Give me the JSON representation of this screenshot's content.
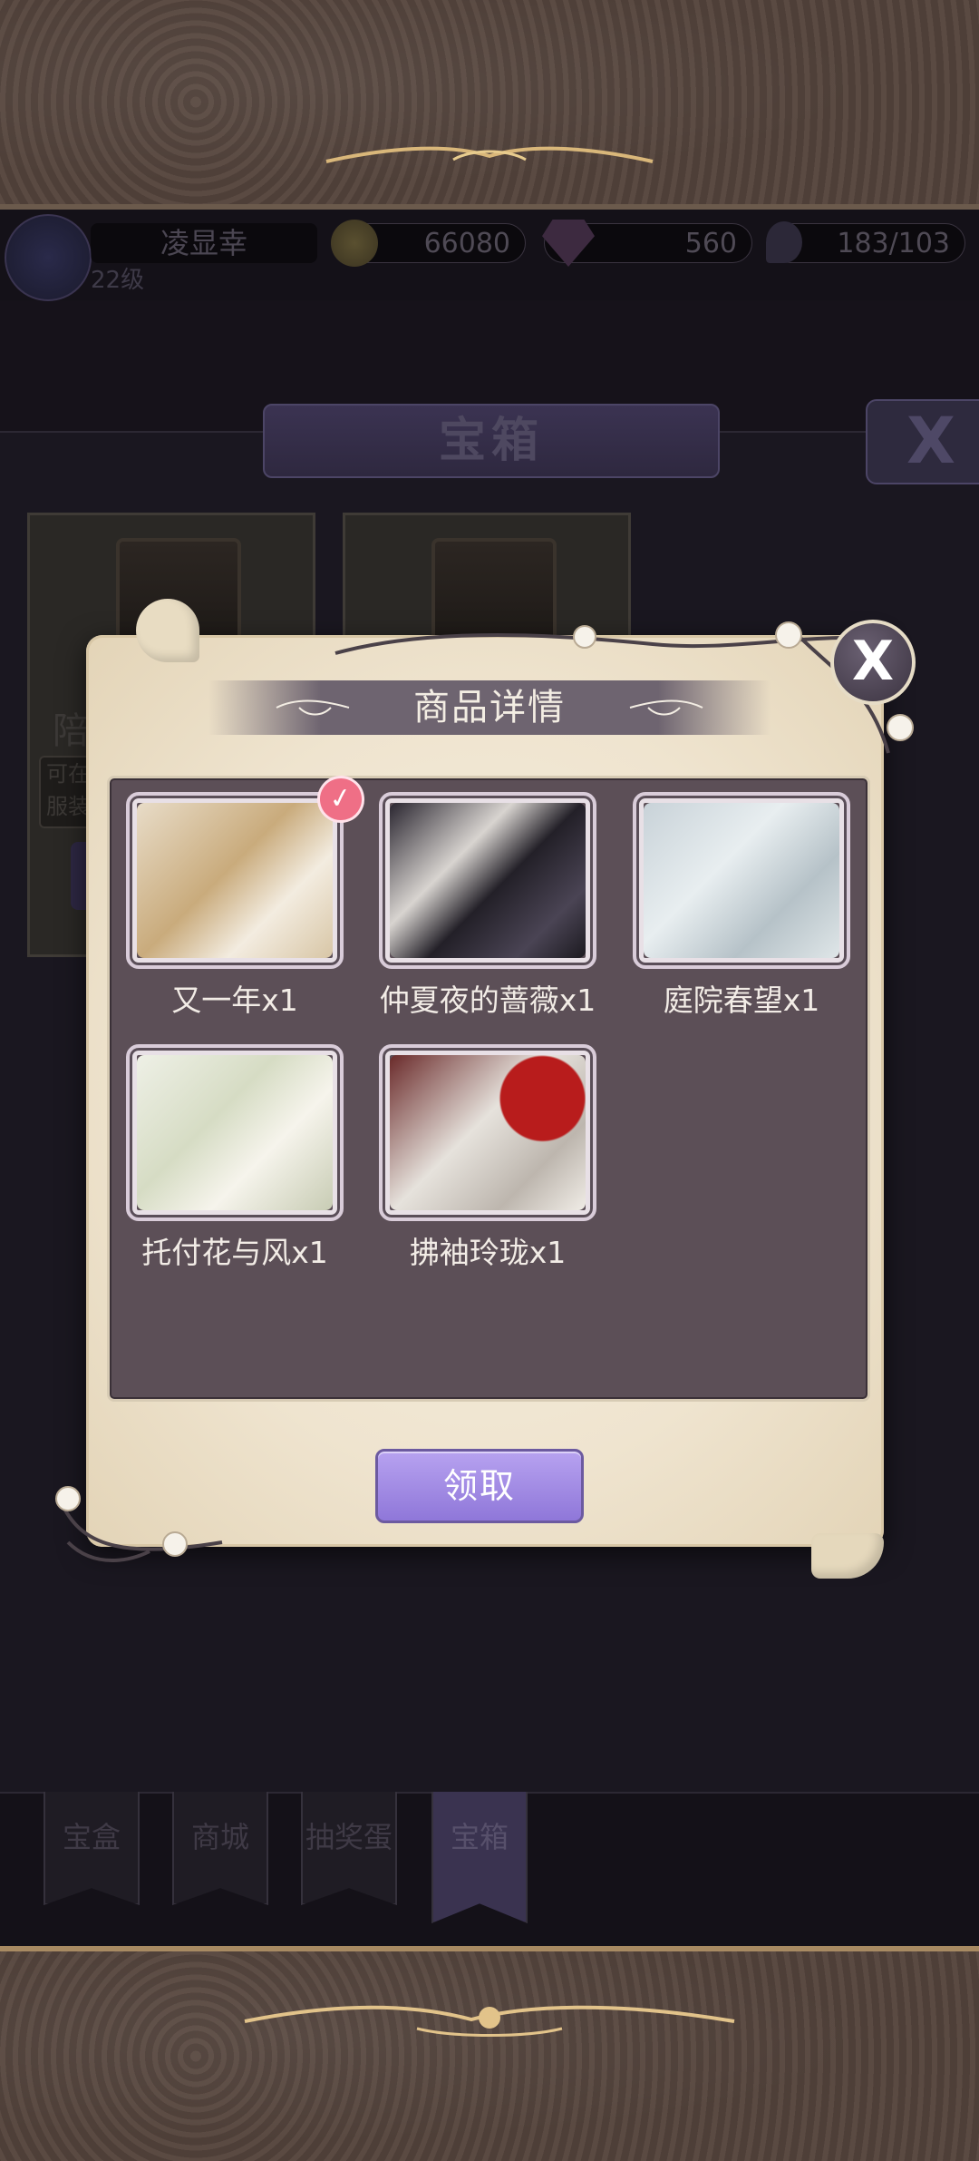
{
  "player": {
    "name": "凌显幸",
    "level": "22级"
  },
  "currency": {
    "gold": "66080",
    "gems": "560",
    "stamina": "183/103"
  },
  "background": {
    "window_title": "宝箱",
    "close_glyph": "X",
    "card_partial_title": "陪",
    "card_partial_desc_line1": "可在",
    "card_partial_desc_line2": "服装"
  },
  "tabs": [
    {
      "label": "宝盒",
      "active": false
    },
    {
      "label": "商城",
      "active": false
    },
    {
      "label": "抽奖蛋",
      "active": false
    },
    {
      "label": "宝箱",
      "active": true
    }
  ],
  "modal": {
    "title": "商品详情",
    "close_glyph": "X",
    "check_glyph": "✓",
    "items": [
      {
        "label": "又一年x1",
        "selected": true,
        "tone": "gold"
      },
      {
        "label": "仲夏夜的蔷薇x1",
        "selected": false,
        "tone": "dark"
      },
      {
        "label": "庭院春望x1",
        "selected": false,
        "tone": "silver"
      },
      {
        "label": "托付花与风x1",
        "selected": false,
        "tone": "cream"
      },
      {
        "label": "拂袖玲珑x1",
        "selected": false,
        "tone": "red"
      }
    ],
    "claim_button": "领取"
  },
  "colors": {
    "accent_purple": "#9a82e0",
    "check_pink": "#ef6f86",
    "panel": "#5c4f57",
    "parchment": "#f2e8d5"
  }
}
